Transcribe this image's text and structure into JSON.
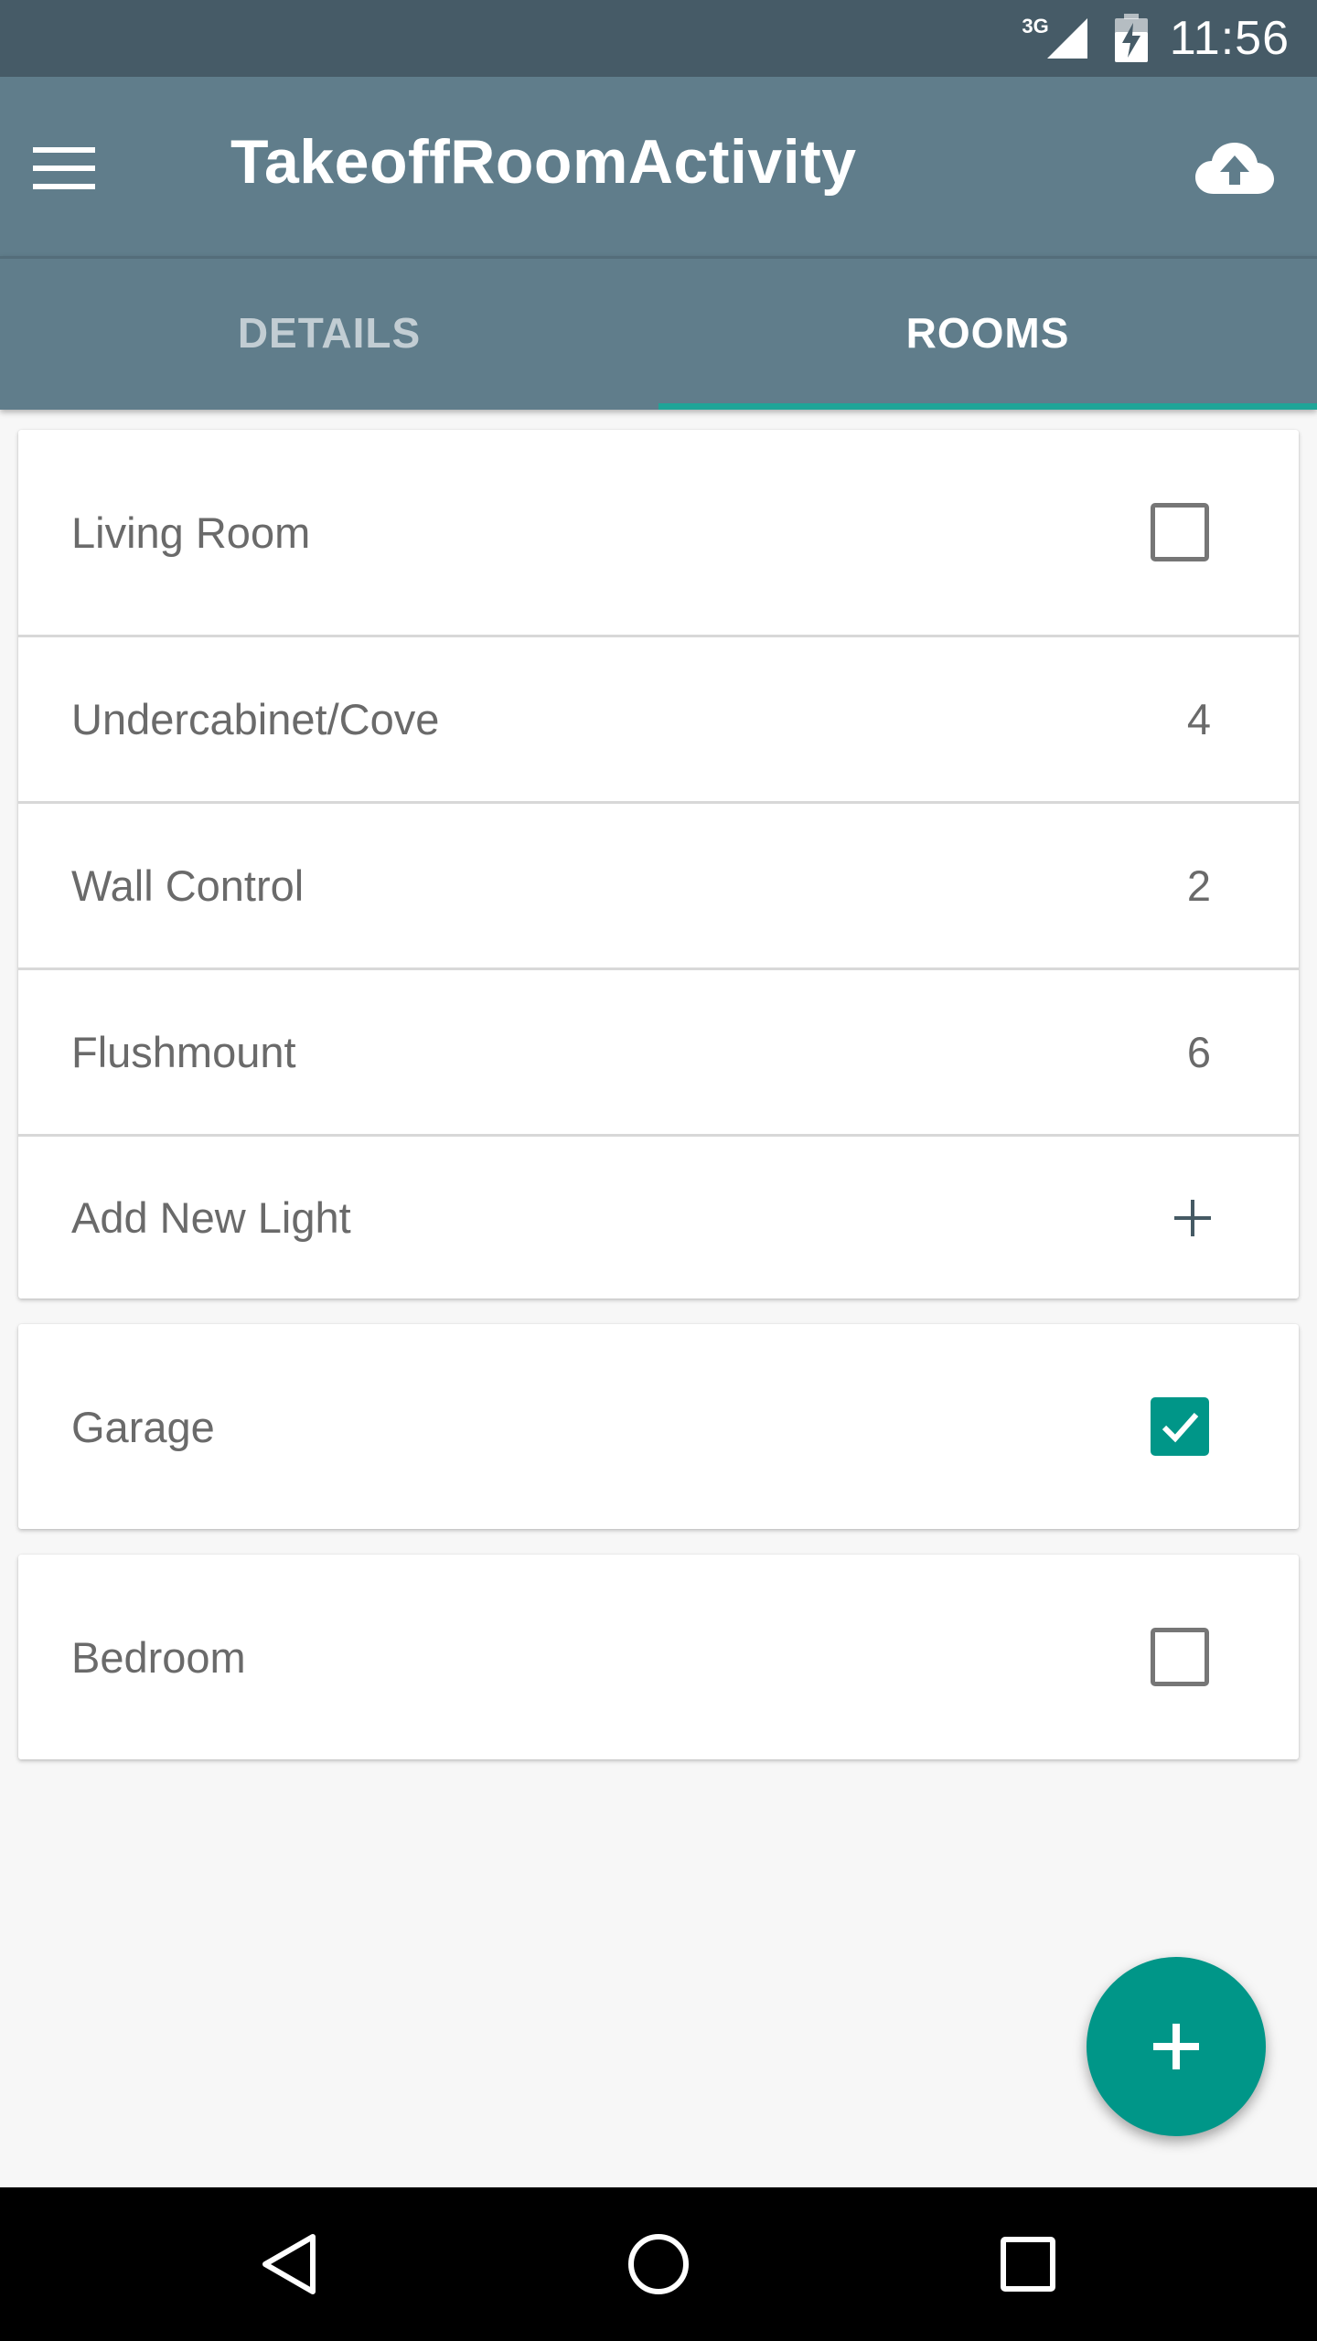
{
  "status_bar": {
    "network": "3G",
    "time": "11:56",
    "icons": [
      "signal-icon",
      "battery-charging-icon"
    ]
  },
  "app_bar": {
    "title": "TakeoffRoomActivity",
    "icons": [
      "menu-icon",
      "cloud-upload-icon"
    ]
  },
  "tabs": [
    {
      "label": "DETAILS",
      "active": false
    },
    {
      "label": "ROOMS",
      "active": true
    }
  ],
  "colors": {
    "primary": "#607d8b",
    "primary_dark": "#465b67",
    "accent": "#009688",
    "tab_indicator": "#1fa598"
  },
  "rooms": [
    {
      "name": "Living Room",
      "checked": false,
      "lights": [
        {
          "name": "Undercabinet/Cove",
          "count": "4"
        },
        {
          "name": "Wall Control",
          "count": "2"
        },
        {
          "name": "Flushmount",
          "count": "6"
        }
      ],
      "add_light_label": "Add New Light"
    },
    {
      "name": "Garage",
      "checked": true
    },
    {
      "name": "Bedroom",
      "checked": false
    }
  ],
  "fab": {
    "icon": "add-icon"
  },
  "nav_bar": {
    "icons": [
      "back-icon",
      "home-icon",
      "recents-icon"
    ]
  }
}
